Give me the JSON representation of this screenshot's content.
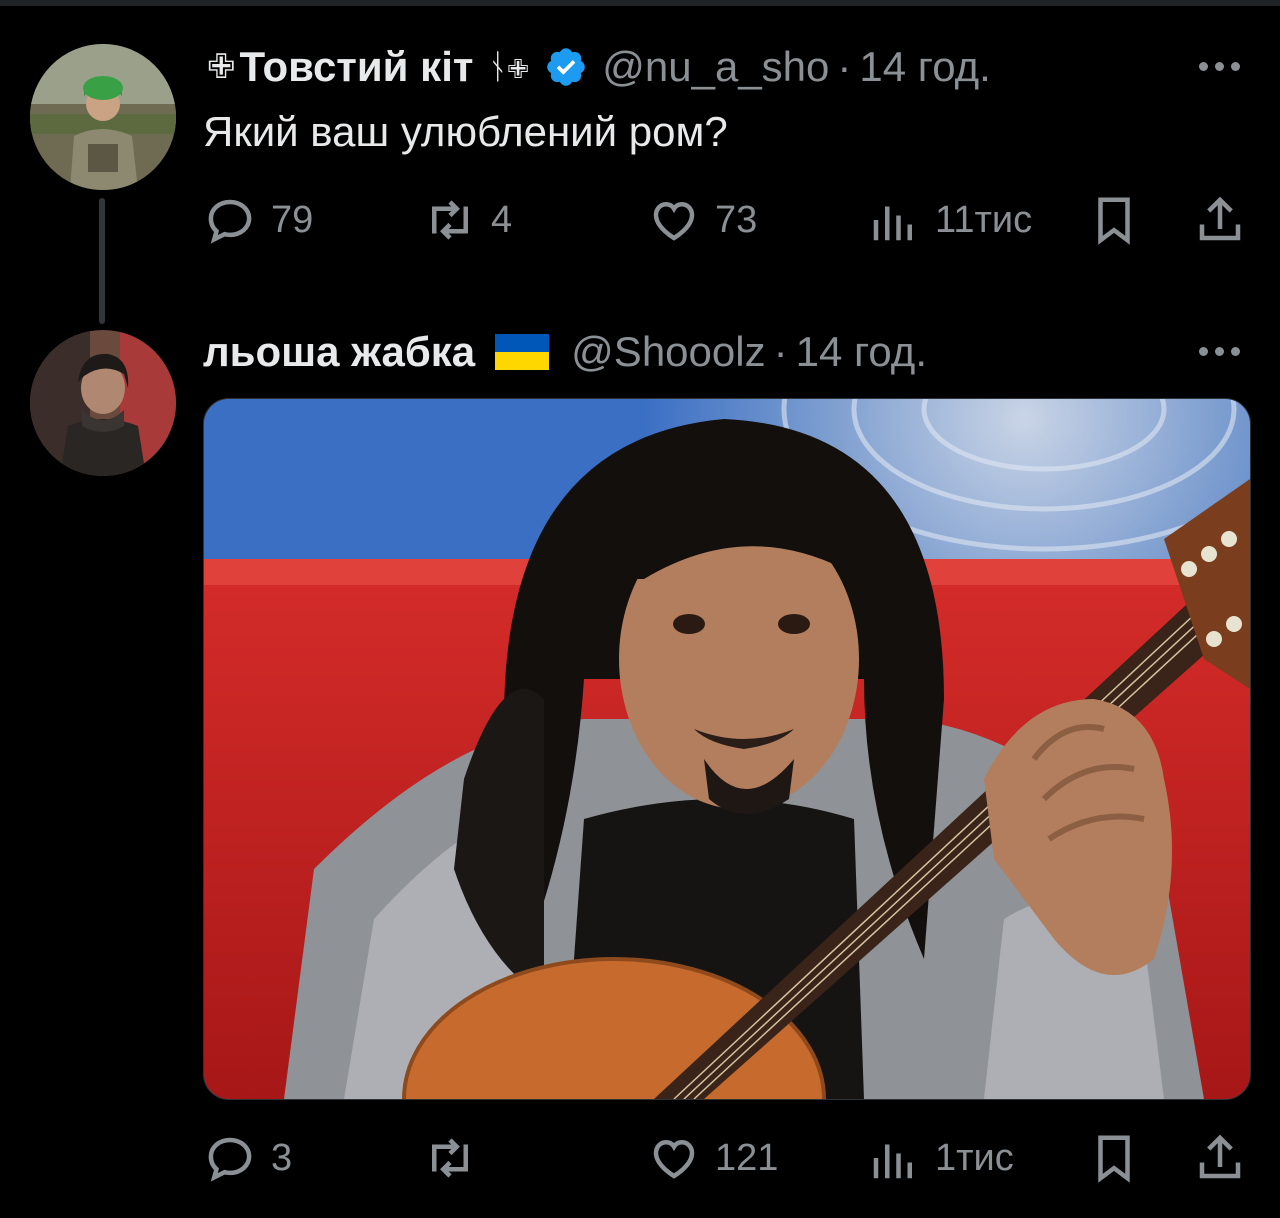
{
  "tweets": [
    {
      "display_name": "Товстий кіт",
      "name_prefix_symbol": "✙",
      "name_suffix_symbols": "ᚾ✙",
      "verified": true,
      "handle": "@nu_a_sho",
      "separator": "·",
      "time": "14 год.",
      "text": "Який ваш улюблений ром?",
      "actions": {
        "replies": "79",
        "reposts": "4",
        "likes": "73",
        "views": "11тис"
      }
    },
    {
      "display_name": "льоша жабка",
      "flag": "ukraine-flag",
      "handle": "@Shooolz",
      "separator": "·",
      "time": "14 год.",
      "actions": {
        "replies": "3",
        "reposts": "",
        "likes": "121",
        "views": "1тис"
      }
    }
  ],
  "colors": {
    "background": "#000000",
    "text": "#e7e9ea",
    "muted": "#8b9095",
    "verified_blue": "#1d9bf0",
    "flag_blue": "#0057b7",
    "flag_yellow": "#ffd700"
  }
}
